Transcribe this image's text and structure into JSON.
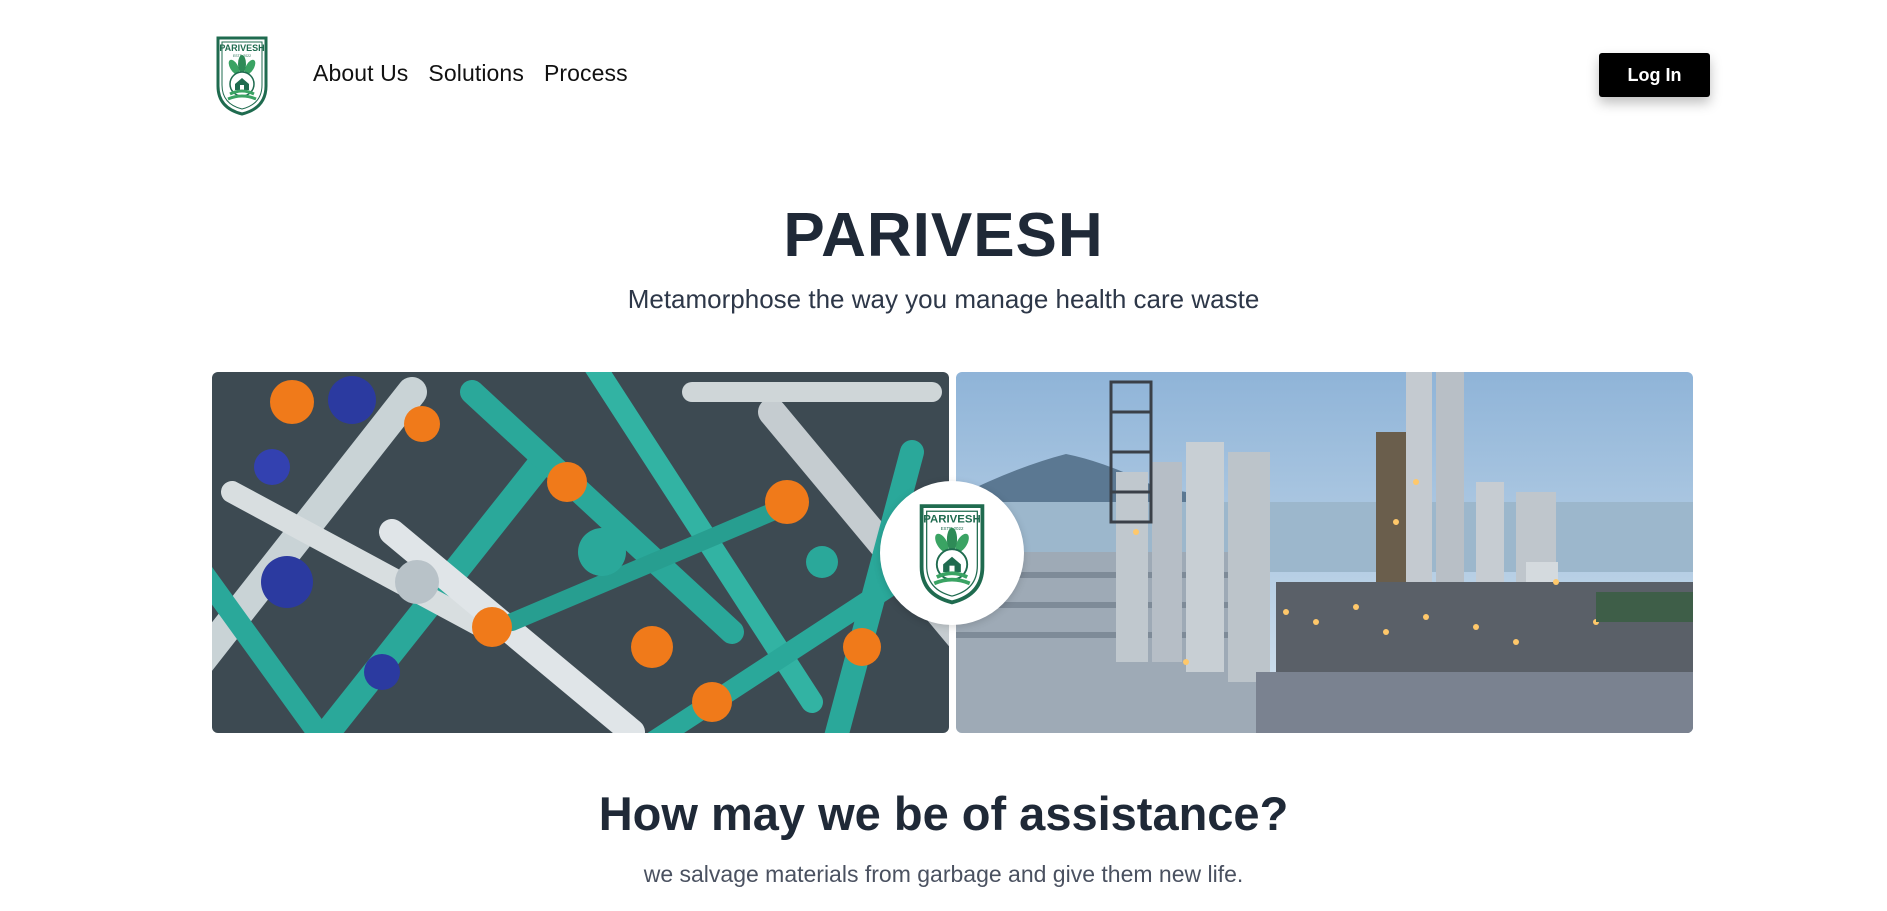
{
  "header": {
    "logo": {
      "brand": "PARIVESH",
      "estd": "ESTD 2022",
      "tagline": "MANAGE WASTE EFFECTIVELY",
      "icon": "leaf-shield-logo-icon"
    },
    "nav": [
      {
        "label": "About Us"
      },
      {
        "label": "Solutions"
      },
      {
        "label": "Process"
      }
    ],
    "login_label": "Log In"
  },
  "hero": {
    "title": "PARIVESH",
    "subtitle": "Metamorphose the way you manage health care waste"
  },
  "images": {
    "left": "medical-syringes-photo",
    "right": "industrial-plant-photo"
  },
  "section": {
    "title": "How may we be of assistance?",
    "subtitle": "we salvage materials from garbage and give them new life."
  },
  "colors": {
    "brand_green": "#1f6b4f",
    "leaf_green": "#3aa363",
    "teal": "#2aa89a",
    "orange": "#f07a1a",
    "text_dark": "#1f2937",
    "button_bg": "#000000"
  }
}
